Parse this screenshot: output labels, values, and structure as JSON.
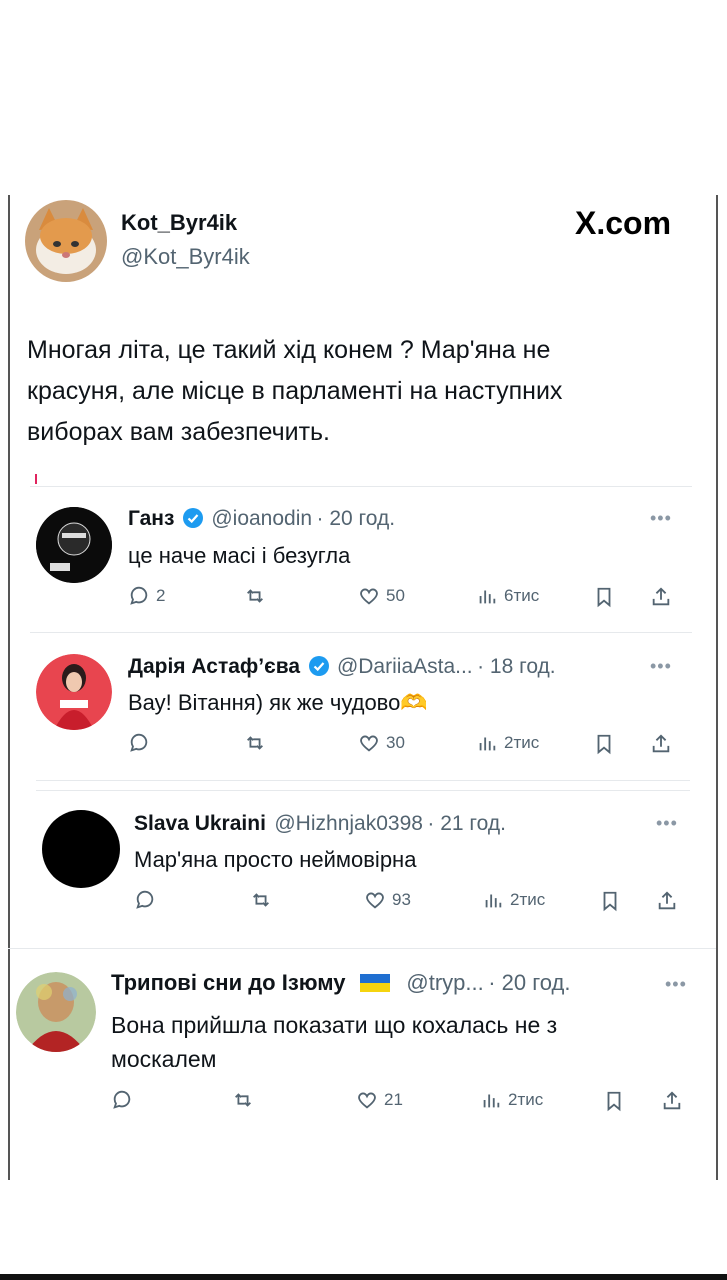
{
  "post": {
    "name": "Kot_Byr4ik",
    "handle": "@Kot_Byr4ik",
    "brand": "X.com",
    "lines": [
      "Многая літа,  це такий хід конем ? Мар'яна не",
      "красуня, але місце в парламенті на наступних",
      "виборах вам забезпечить."
    ]
  },
  "replies": [
    {
      "name": "Ганз",
      "handle": "@ioanodin",
      "time": "· 20 год.",
      "text": "це наче масі і безугла",
      "replies": "2",
      "likes": "50",
      "views": "6тис"
    },
    {
      "name": "Дарія Астаф’єва",
      "handle": "@DariiaAsta...",
      "time": "· 18 год.",
      "text": "Вау! Вітання) як же чудово🫶",
      "replies": "",
      "likes": "30",
      "views": "2тис"
    },
    {
      "name": "Slava Ukraini",
      "handle": "@Hizhnjak0398",
      "time": "· 21 год.",
      "text": "Мар'яна просто неймовірна",
      "replies": "",
      "likes": "93",
      "views": "2тис"
    },
    {
      "name": "Трипові сни до Ізюму",
      "handle": "@tryp...",
      "time": "· 20 год.",
      "lines": [
        "Вона прийшла показати що кохалась не з",
        "москалем"
      ],
      "replies": "",
      "likes": "21",
      "views": "2тис"
    }
  ],
  "colors": {
    "verified": "#1d9bf0",
    "text": "#0f1419",
    "muted": "#536471"
  }
}
